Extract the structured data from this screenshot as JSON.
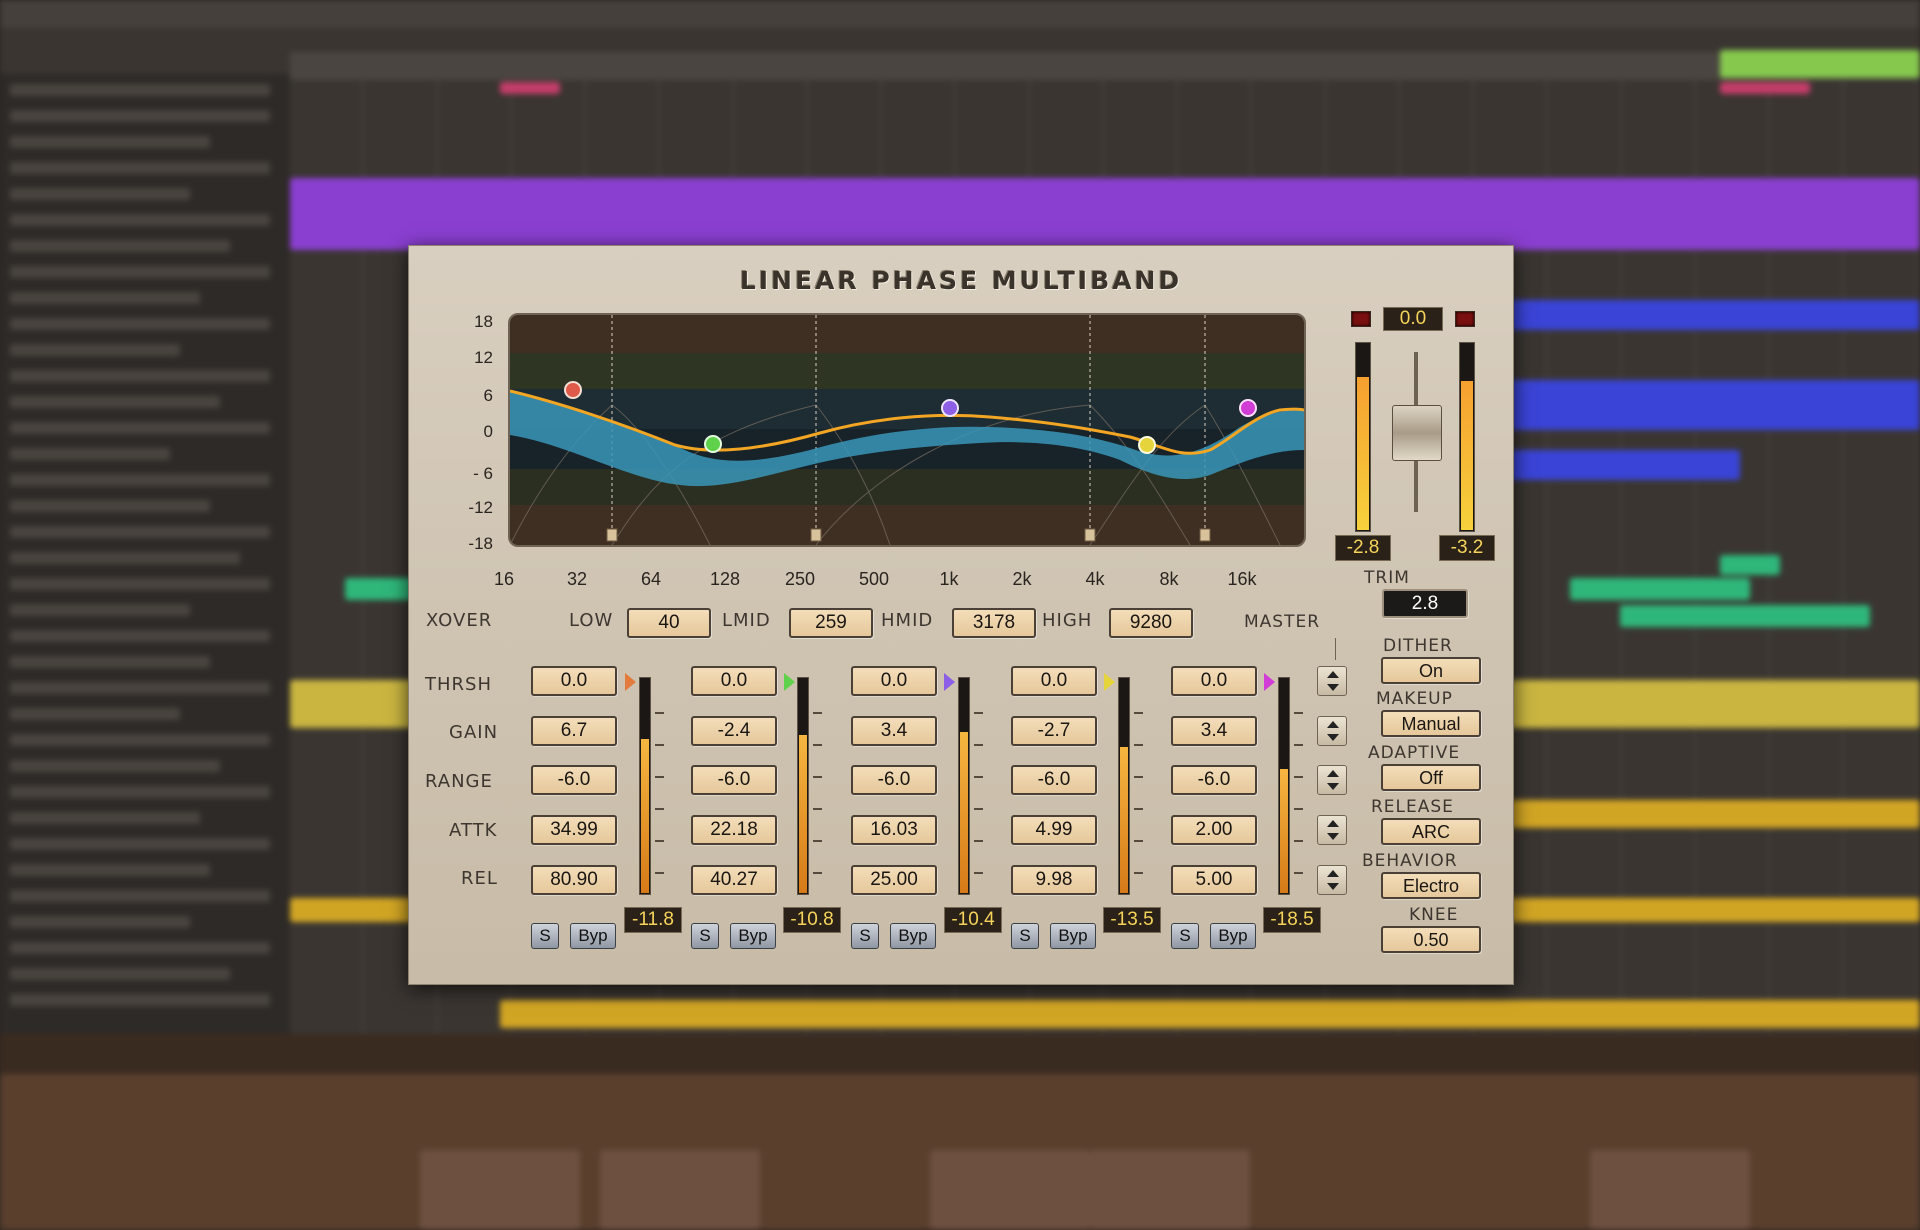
{
  "plugin": {
    "title": "LINEAR PHASE MULTIBAND",
    "db_scale": [
      "18",
      "12",
      "6",
      "0",
      "- 6",
      "-12",
      "-18"
    ],
    "freq_scale": [
      "16",
      "32",
      "64",
      "128",
      "250",
      "500",
      "1k",
      "2k",
      "4k",
      "8k",
      "16k"
    ],
    "xover": {
      "label": "XOVER",
      "low_label": "LOW",
      "low": "40",
      "lmid_label": "LMID",
      "lmid": "259",
      "hmid_label": "HMID",
      "hmid": "3178",
      "high_label": "HIGH",
      "high": "9280"
    },
    "master_label": "MASTER",
    "row_labels": [
      "THRSH",
      "GAIN",
      "RANGE",
      "ATTK",
      "REL"
    ],
    "bands": [
      {
        "thrsh": "0.0",
        "gain": "6.7",
        "range": "-6.0",
        "attk": "34.99",
        "rel": "80.90",
        "meter": "-11.8",
        "meter_level": 0.72,
        "color": "#e37b3c",
        "solo": "S",
        "bypass": "Byp"
      },
      {
        "thrsh": "0.0",
        "gain": "-2.4",
        "range": "-6.0",
        "attk": "22.18",
        "rel": "40.27",
        "meter": "-10.8",
        "meter_level": 0.74,
        "color": "#5fd14a",
        "solo": "S",
        "bypass": "Byp"
      },
      {
        "thrsh": "0.0",
        "gain": "3.4",
        "range": "-6.0",
        "attk": "16.03",
        "rel": "25.00",
        "meter": "-10.4",
        "meter_level": 0.75,
        "color": "#8c5fe6",
        "solo": "S",
        "bypass": "Byp"
      },
      {
        "thrsh": "0.0",
        "gain": "-2.7",
        "range": "-6.0",
        "attk": "4.99",
        "rel": "9.98",
        "meter": "-13.5",
        "meter_level": 0.68,
        "color": "#e6d43c",
        "solo": "S",
        "bypass": "Byp"
      },
      {
        "thrsh": "0.0",
        "gain": "3.4",
        "range": "-6.0",
        "attk": "2.00",
        "rel": "5.00",
        "meter": "-18.5",
        "meter_level": 0.58,
        "color": "#d23cd6",
        "solo": "S",
        "bypass": "Byp"
      }
    ],
    "output": {
      "peak": "0.0",
      "left_meter": "-2.8",
      "left_level": 0.82,
      "right_meter": "-3.2",
      "right_level": 0.8,
      "fader_level": 0.5
    },
    "trim_label": "TRIM",
    "trim": "2.8",
    "dither_label": "DITHER",
    "dither": "On",
    "makeup_label": "MAKEUP",
    "makeup": "Manual",
    "adaptive_label": "ADAPTIVE",
    "adaptive": "Off",
    "release_label": "RELEASE",
    "release": "ARC",
    "behavior_label": "BEHAVIOR",
    "behavior": "Electro",
    "knee_label": "KNEE",
    "knee": "0.50",
    "colors": {
      "curve": "#f2a623",
      "fill": "#3a97b8",
      "panel": "#d6cbbb"
    }
  }
}
